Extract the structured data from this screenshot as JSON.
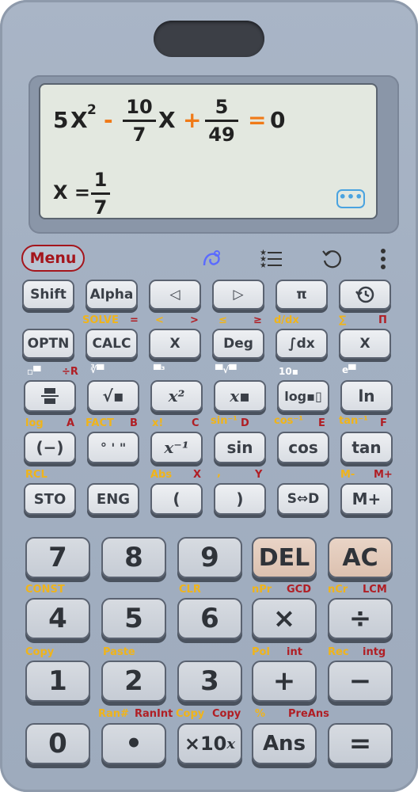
{
  "display": {
    "eq": {
      "coef": "5",
      "var": "X",
      "exp": "2",
      "minus": "-",
      "f1_num": "10",
      "f1_den": "7",
      "var2": "X",
      "plus": "+",
      "f2_num": "5",
      "f2_den": "49",
      "equals": "=",
      "rhs": "0"
    },
    "result": {
      "lhs": "X =",
      "num": "1",
      "den": "7"
    },
    "more": "•••"
  },
  "menu": {
    "label": "Menu"
  },
  "row1": {
    "shift": "Shift",
    "alpha": "Alpha",
    "left": "◁",
    "right": "▷",
    "pi": "π"
  },
  "row1_labels": {
    "solve": "SOLVE",
    "eq": "=",
    "lt": "<",
    "gt": ">",
    "le": "≤",
    "ge": "≥",
    "ddx": "d/dx",
    "sum": "∑",
    "prod": "Π"
  },
  "row2": {
    "optn": "OPTN",
    "calc": "CALC",
    "x": "X",
    "deg": "Deg",
    "intdx": "∫dx",
    "x2": "X"
  },
  "row2_labels": {
    "divr": "÷R"
  },
  "row3": {
    "frac": "▭",
    "sqrt": "√▪",
    "sq": "x²",
    "pow": "x▪",
    "log": "log▪▯",
    "ln": "ln"
  },
  "row3_labels": {
    "log": "log",
    "a": "A",
    "fact": "FACT",
    "b": "B",
    "xf": "x!",
    "c": "C",
    "sin1": "sin⁻¹",
    "d": "D",
    "cos1": "cos⁻¹",
    "e": "E",
    "tan1": "tan⁻¹",
    "f": "F",
    "ten": "10▪"
  },
  "row4": {
    "neg": "(−)",
    "dms": "° ' \"",
    "inv": "x⁻¹",
    "sin": "sin",
    "cos": "cos",
    "tan": "tan"
  },
  "row4_labels": {
    "rcl": "RCL",
    "abs": "Abs",
    "x": "X",
    "comma": ",",
    "y": "Y",
    "mminus": "M-",
    "mplus": "M+"
  },
  "row5": {
    "sto": "STO",
    "eng": "ENG",
    "lpar": "(",
    "rpar": ")",
    "sd": "S⇔D",
    "mplus": "M+"
  },
  "num1": {
    "k7": "7",
    "k8": "8",
    "k9": "9",
    "del": "DEL",
    "ac": "AC"
  },
  "num1_labels": {
    "const": "CONST",
    "clr": "CLR",
    "npr": "nPr",
    "gcd": "GCD",
    "ncr": "nCr",
    "lcm": "LCM"
  },
  "num2": {
    "k4": "4",
    "k5": "5",
    "k6": "6",
    "mul": "×",
    "div": "÷"
  },
  "num2_labels": {
    "copy": "Copy",
    "paste": "Paste",
    "pol": "Pol",
    "int": "int",
    "rec": "Rec",
    "intg": "intg"
  },
  "num3": {
    "k1": "1",
    "k2": "2",
    "k3": "3",
    "add": "+",
    "sub": "−"
  },
  "num3_labels": {
    "ran": "Ran#",
    "ranint": "RanInt",
    "copy1": "Copy",
    "copy2": "Copy",
    "pct": "%",
    "preans": "PreAns"
  },
  "num4": {
    "k0": "0",
    "dot": "•",
    "exp10": "×10",
    "expx": "x",
    "ans": "Ans",
    "eq": "="
  }
}
